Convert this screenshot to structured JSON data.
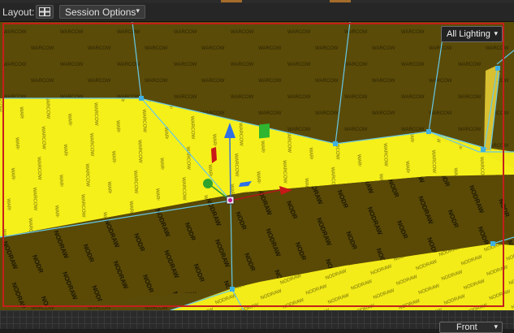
{
  "toolbar": {
    "layout_label": "Layout:",
    "session_label": "Session Options",
    "dropdown_caret": "▾"
  },
  "viewport": {
    "lighting_label": "All Lighting",
    "texture_wall_text": "WARCOW",
    "texture_floor_text": "NODRAW",
    "colors": {
      "floor_yellow": "#f6f01a",
      "wall_olive": "#5b4b08",
      "selection_edge": "#66c8e8",
      "frame_red": "#c3201b"
    }
  },
  "bottom": {
    "view_label": "Front"
  }
}
